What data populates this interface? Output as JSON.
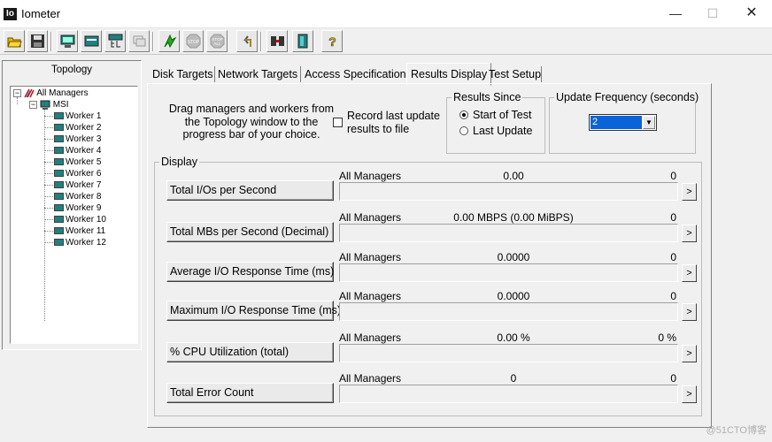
{
  "window": {
    "icon_text": "Io",
    "title": "Iometer",
    "minimize": "—",
    "maximize": "☐",
    "close": "✕"
  },
  "toolbar": {
    "buttons": [
      {
        "icon": "open-folder-icon"
      },
      {
        "icon": "save-disk-icon"
      },
      {
        "icon": "start-display-icon"
      },
      {
        "icon": "new-manager-icon"
      },
      {
        "icon": "new-worker-icon"
      },
      {
        "icon": "copy-worker-icon"
      },
      {
        "icon": "start-flag-icon"
      },
      {
        "icon": "stop-icon"
      },
      {
        "icon": "stop-all-icon"
      },
      {
        "icon": "reset-icon"
      },
      {
        "icon": "disconnect-icon"
      },
      {
        "icon": "exit-icon"
      },
      {
        "icon": "help-icon"
      }
    ],
    "stop_text": "STOP",
    "stop_all_text": "STOP",
    "stop_all_sub": "ALL",
    "help_text": "?"
  },
  "topology": {
    "title": "Topology",
    "root": "All Managers",
    "manager": "MSI",
    "workers": [
      "Worker 1",
      "Worker 2",
      "Worker 3",
      "Worker 4",
      "Worker 5",
      "Worker 6",
      "Worker 7",
      "Worker 8",
      "Worker 9",
      "Worker 10",
      "Worker 11",
      "Worker 12"
    ],
    "expander_symbol": "−"
  },
  "tabs": [
    "Disk Targets",
    "Network Targets",
    "Access Specifications",
    "Results Display",
    "Test Setup"
  ],
  "active_tab": "Results Display",
  "drag_text": "Drag managers and workers from the Topology window to the progress bar of your choice.",
  "record": {
    "label": "Record last update results to file",
    "checked": false
  },
  "results_since": {
    "label": "Results Since",
    "options": [
      "Start of Test",
      "Last Update"
    ],
    "selected": "Start of Test"
  },
  "update_frequency": {
    "label": "Update Frequency (seconds)",
    "value": "2",
    "dropdown_symbol": "▼"
  },
  "display": {
    "label": "Display",
    "arrow": ">",
    "rows": [
      {
        "button": "Total I/Os per Second",
        "manager": "All Managers",
        "value": "0.00",
        "max": "0"
      },
      {
        "button": "Total MBs per Second (Decimal)",
        "manager": "All Managers",
        "value": "0.00 MBPS (0.00 MiBPS)",
        "max": "0"
      },
      {
        "button": "Average I/O Response Time (ms)",
        "manager": "All Managers",
        "value": "0.0000",
        "max": "0"
      },
      {
        "button": "Maximum I/O Response Time (ms)",
        "manager": "All Managers",
        "value": "0.0000",
        "max": "0"
      },
      {
        "button": "% CPU Utilization (total)",
        "manager": "All Managers",
        "value": "0.00 %",
        "max": "0 %"
      },
      {
        "button": "Total Error Count",
        "manager": "All Managers",
        "value": "0",
        "max": "0"
      }
    ]
  },
  "watermark": "@51CTO博客"
}
